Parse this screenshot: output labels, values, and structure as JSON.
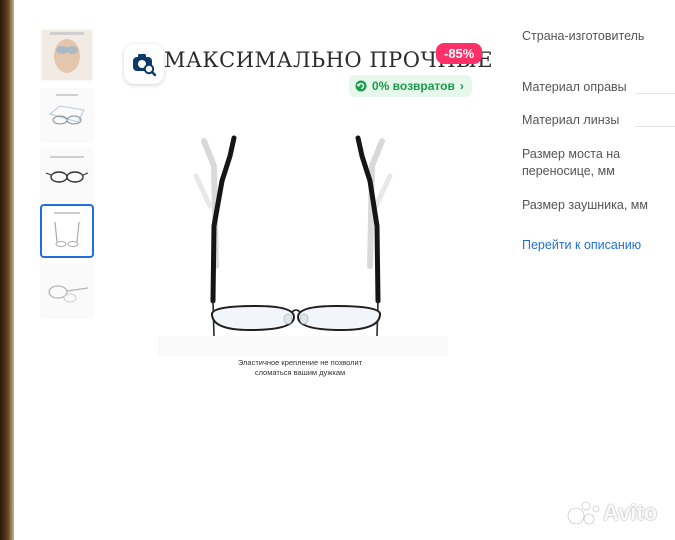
{
  "gallery": {
    "thumbnails": [
      {
        "name": "thumbnail-1",
        "icon": "hands-cleaning-glasses"
      },
      {
        "name": "thumbnail-2",
        "icon": "glasses-diagram"
      },
      {
        "name": "thumbnail-3",
        "icon": "glasses-front"
      },
      {
        "name": "thumbnail-4",
        "icon": "glasses-hinge-flex",
        "selected": true
      },
      {
        "name": "thumbnail-5",
        "icon": "glasses-side"
      }
    ]
  },
  "main_image": {
    "headline": "МАКСИМАЛЬНО ПРОЧНЫЕ",
    "caption_line1": "Эластичное крепление не позволит",
    "caption_line2": "сломаться вашим дужкам"
  },
  "badges": {
    "discount": "-85%",
    "returns": "0% возвратов",
    "discount_color": "#ff2f67",
    "returns_color": "#1a9c4b"
  },
  "specs": {
    "rows": [
      {
        "label": "Страна-изготовитель"
      },
      {
        "label": "Материал оправы"
      },
      {
        "label": "Материал линзы"
      },
      {
        "label": "Размер моста на переносице, мм"
      },
      {
        "label": "Размер заушника, мм"
      }
    ],
    "link": "Перейти к описанию",
    "link_color": "#1f6fe0"
  },
  "watermark": {
    "text": "Avito"
  }
}
